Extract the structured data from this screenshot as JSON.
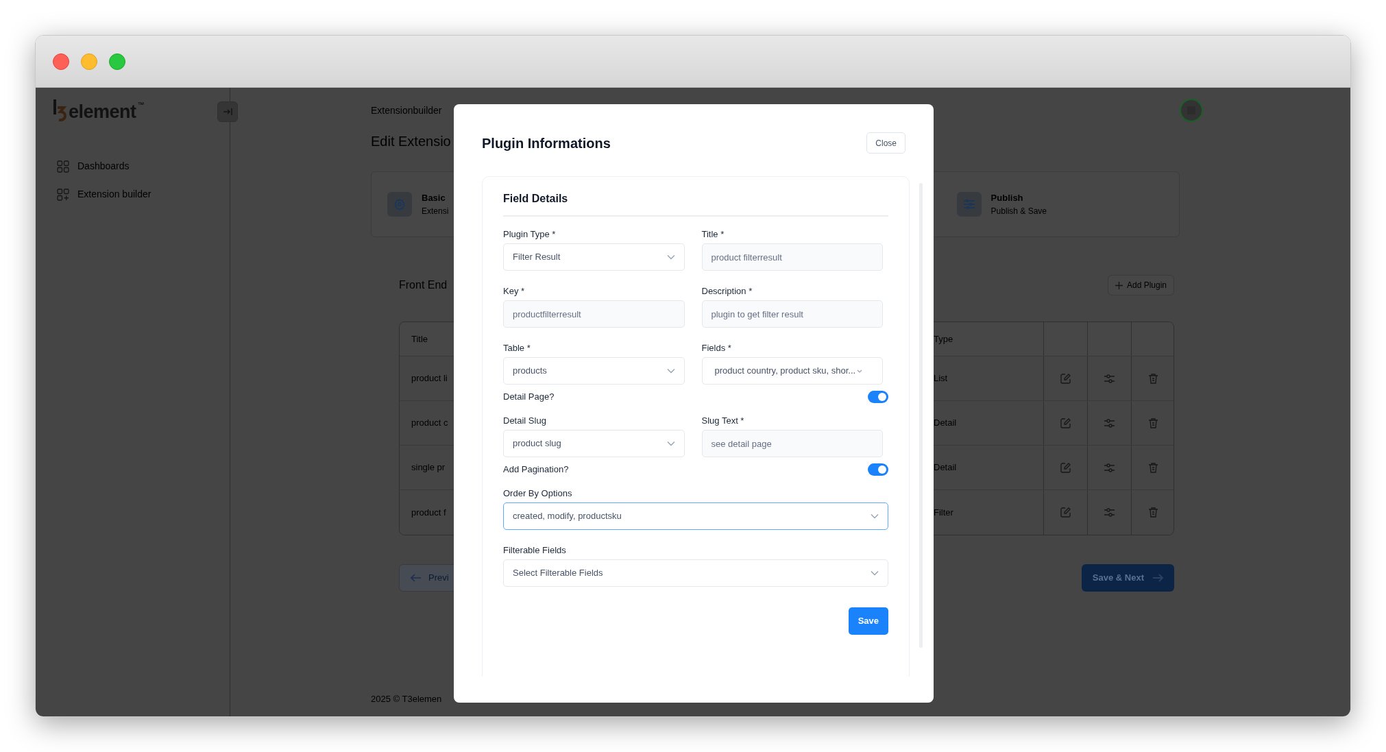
{
  "sidebar": {
    "logo": {
      "text": "element",
      "trademark": "™"
    },
    "items": [
      {
        "label": "Dashboards",
        "kind": "grid"
      },
      {
        "label": "Extension builder",
        "kind": "grid-plus"
      }
    ]
  },
  "header": {
    "breadcrumb": "Extensionbuilder"
  },
  "page": {
    "title": "Edit Extensio",
    "steps": [
      {
        "title": "Basic",
        "subtitle": "Extensi",
        "kind": "gear"
      },
      {
        "title": "Publish",
        "subtitle": "Publish & Save",
        "kind": "sliders"
      }
    ],
    "section_title": "Front End",
    "add_button": "Add Plugin",
    "table": {
      "columns": [
        "Title",
        "Type"
      ],
      "rows": [
        {
          "title": "product li",
          "type": "List"
        },
        {
          "title": "product c",
          "type": "Detail"
        },
        {
          "title": "single pr",
          "type": "Detail"
        },
        {
          "title": "product f",
          "type": "Filter"
        }
      ]
    },
    "previous_button": "Previ",
    "next_button": "Save & Next"
  },
  "footer": "2025 ©  T3elemen",
  "modal": {
    "title": "Plugin Informations",
    "close_button": "Close",
    "section_title": "Field Details",
    "fields": [
      {
        "kind": "select",
        "label": "Plugin Type *",
        "value": "Filter Result",
        "full_width": false,
        "focused": false
      },
      {
        "kind": "input",
        "label": "Title *",
        "value": "product filterresult",
        "full_width": false,
        "disabled": true
      },
      {
        "kind": "input",
        "label": "Key *",
        "value": "productfilterresult",
        "full_width": false,
        "disabled": true
      },
      {
        "kind": "input",
        "label": "Description *",
        "value": "plugin to get filter result",
        "full_width": false,
        "disabled": true
      },
      {
        "kind": "select",
        "label": "Table *",
        "value": "products",
        "full_width": false,
        "focused": false
      },
      {
        "kind": "multiselect",
        "label": "Fields *",
        "value": "product country, product sku, shor...",
        "full_width": false
      },
      {
        "kind": "toggle",
        "label": "Detail Page?",
        "on": true
      },
      {
        "kind": "select",
        "label": "Detail Slug",
        "value": "product slug",
        "full_width": false,
        "focused": false
      },
      {
        "kind": "input",
        "label": "Slug Text *",
        "value": "see detail page",
        "full_width": false,
        "disabled": true
      },
      {
        "kind": "toggle",
        "label": "Add Pagination?",
        "on": true
      },
      {
        "kind": "select",
        "label": "Order By Options",
        "value": "created, modify, productsku",
        "full_width": true,
        "focused": true
      },
      {
        "kind": "select",
        "label": "Filterable Fields",
        "placeholder": "Select Filterable Fields",
        "full_width": true,
        "focused": false
      }
    ],
    "save_button": "Save"
  }
}
